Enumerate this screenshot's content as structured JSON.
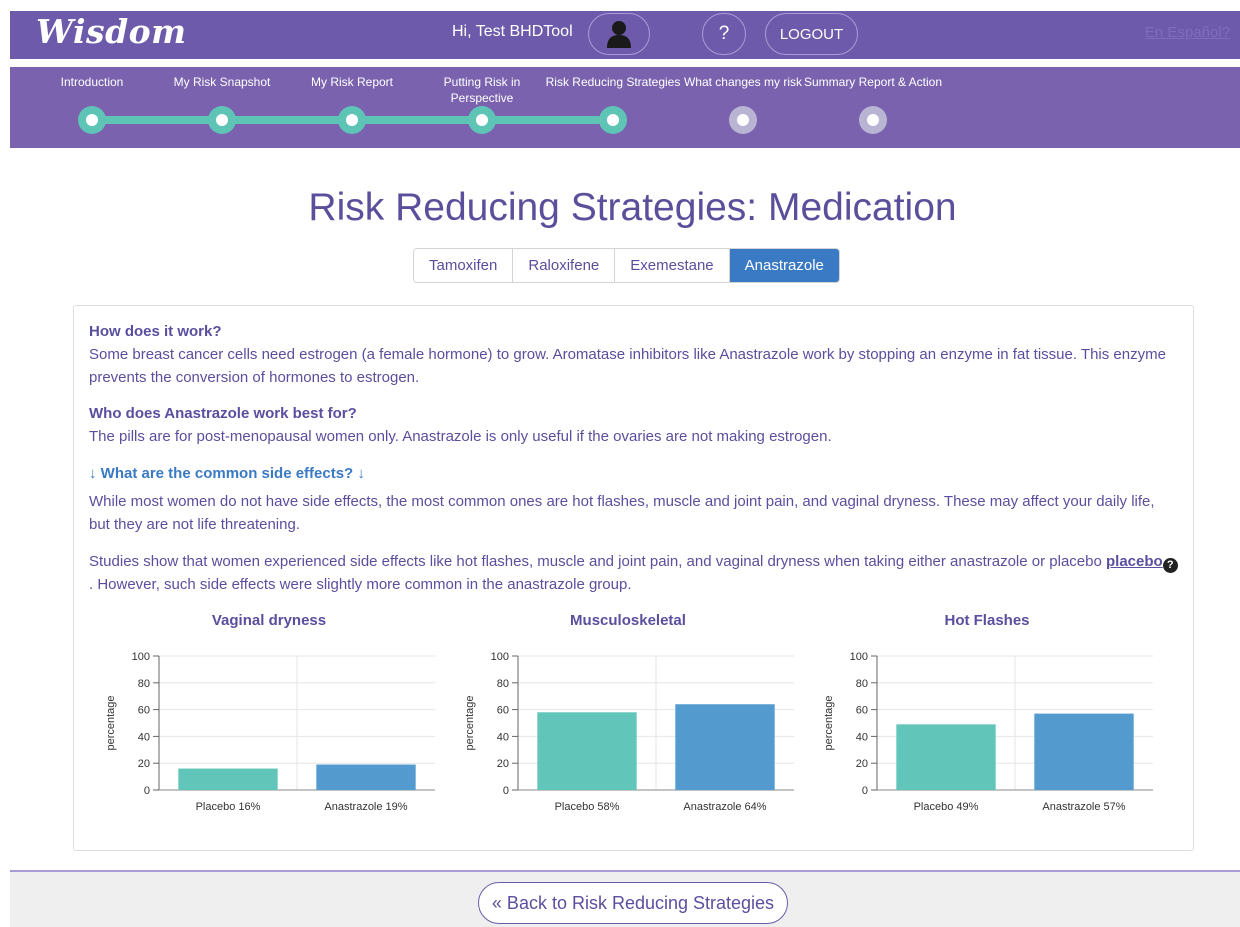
{
  "header": {
    "logo": "Wisdom",
    "greeting": "Hi, Test BHDTool",
    "help_label": "?",
    "logout_label": "LOGOUT",
    "language_link": "En Español?"
  },
  "stepper": {
    "steps": [
      {
        "label": "Introduction",
        "state": "done"
      },
      {
        "label": "My Risk Snapshot",
        "state": "done"
      },
      {
        "label": "My Risk Report",
        "state": "done"
      },
      {
        "label": "Putting Risk in Perspective",
        "state": "done"
      },
      {
        "label": "Risk Reducing Strategies",
        "state": "done"
      },
      {
        "label": "What changes my risk",
        "state": "todo"
      },
      {
        "label": "Summary Report & Action",
        "state": "todo"
      }
    ],
    "colors": {
      "done": "#5ec4b6",
      "todo": "#b9b4d3"
    }
  },
  "page_title": "Risk Reducing Strategies: Medication",
  "tabs": [
    {
      "label": "Tamoxifen",
      "active": false
    },
    {
      "label": "Raloxifene",
      "active": false
    },
    {
      "label": "Exemestane",
      "active": false
    },
    {
      "label": "Anastrazole",
      "active": true
    }
  ],
  "content": {
    "q1": "How does it work?",
    "a1": "Some breast cancer cells need estrogen (a female hormone) to grow. Aromatase inhibitors like Anastrazole work by stopping an enzyme in fat tissue. This enzyme prevents the conversion of hormones to estrogen.",
    "q2": "Who does Anastrazole work best for?",
    "a2": "The pills are for post-menopausal women only. Anastrazole is only useful if the ovaries are not making estrogen.",
    "side_effects_title": "↓ What are the common side effects? ↓",
    "side_effects_text": "While most women do not have side effects, the most common ones are hot flashes, muscle and joint pain, and vaginal dryness. These may affect your daily life, but they are not life threatening.",
    "studies_text_1": "Studies show that women experienced side effects like hot flashes, muscle and joint pain, and vaginal dryness when taking either anastrazole or placebo",
    "placebo_link": "placebo",
    "studies_text_2": ". However, such side effects were slightly more common in the anastrazole group."
  },
  "chart_data": [
    {
      "type": "bar",
      "title": "Vaginal dryness",
      "ylabel": "percentage",
      "xlabel": "",
      "ylim": [
        0,
        100
      ],
      "yticks": [
        0,
        20,
        40,
        60,
        80,
        100
      ],
      "categories": [
        "Placebo 16%",
        "Anastrazole 19%"
      ],
      "values": [
        16,
        19
      ],
      "colors": [
        "#62c5b9",
        "#539bcf"
      ],
      "grid": true
    },
    {
      "type": "bar",
      "title": "Musculoskeletal",
      "ylabel": "percentage",
      "xlabel": "",
      "ylim": [
        0,
        100
      ],
      "yticks": [
        0,
        20,
        40,
        60,
        80,
        100
      ],
      "categories": [
        "Placebo 58%",
        "Anastrazole 64%"
      ],
      "values": [
        58,
        64
      ],
      "colors": [
        "#62c5b9",
        "#539bcf"
      ],
      "grid": true
    },
    {
      "type": "bar",
      "title": "Hot Flashes",
      "ylabel": "percentage",
      "xlabel": "",
      "ylim": [
        0,
        100
      ],
      "yticks": [
        0,
        20,
        40,
        60,
        80,
        100
      ],
      "categories": [
        "Placebo 49%",
        "Anastrazole 57%"
      ],
      "values": [
        49,
        57
      ],
      "colors": [
        "#62c5b9",
        "#539bcf"
      ],
      "grid": true
    }
  ],
  "footer": {
    "back_label": "« Back to Risk Reducing Strategies"
  }
}
